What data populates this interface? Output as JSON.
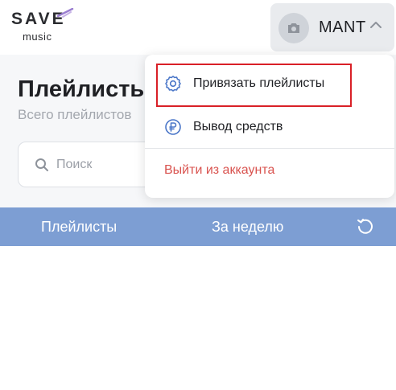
{
  "header": {
    "logo_text": "SAVE",
    "logo_subtext": "music",
    "user_name": "MANT"
  },
  "page": {
    "title": "Плейлисты",
    "subtitle": "Всего плейлистов"
  },
  "search": {
    "placeholder": "Поиск"
  },
  "table": {
    "columns": [
      "Плейлисты",
      "За неделю"
    ]
  },
  "menu": {
    "items": [
      {
        "label": "Привязать плейлисты",
        "icon": "gear-icon"
      },
      {
        "label": "Вывод средств",
        "icon": "ruble-icon"
      }
    ],
    "logout_label": "Выйти из аккаунта"
  },
  "colors": {
    "table_header": "#7d9ed3",
    "accent_icon": "#4a76c8",
    "logout": "#d9534f",
    "highlight": "#d92027",
    "logo_accent": "#9b7fd1"
  }
}
